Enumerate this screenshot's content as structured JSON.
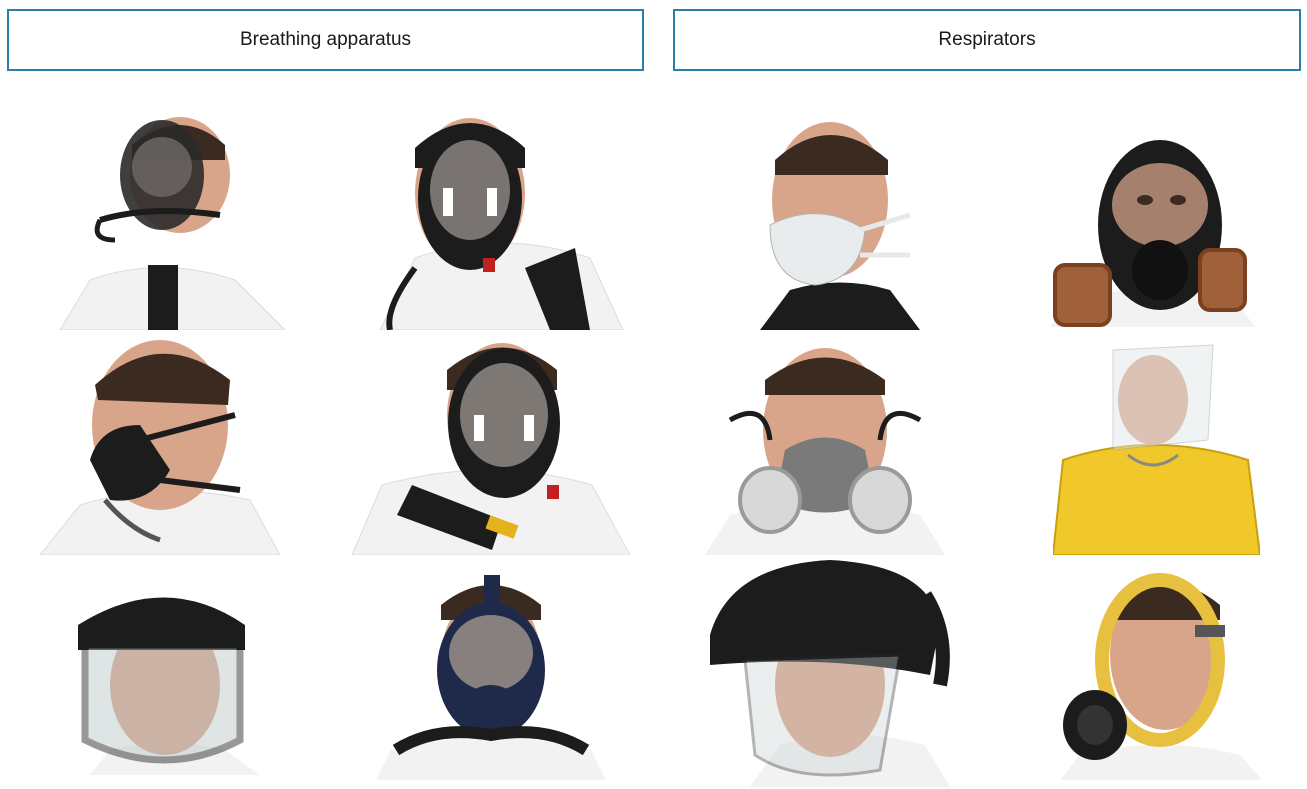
{
  "sections": {
    "left_title": "Breathing apparatus",
    "right_title": "Respirators"
  },
  "colors": {
    "header_border": "#2b7fa6",
    "skin": "#d9a58a",
    "hair": "#3a2a20",
    "suit": "#f2f2f2",
    "mask_black": "#1c1c1c",
    "mask_blue": "#1f2a4a",
    "filter_brown": "#a0603a",
    "mask_grey": "#7a7a7a",
    "suit_yellow": "#f0c82a",
    "visor_yellow": "#e8c040"
  },
  "left_items": [
    {
      "icon": "full-face-mask-hose-icon"
    },
    {
      "icon": "full-face-mask-harness-icon"
    },
    {
      "icon": "half-mask-airline-icon"
    },
    {
      "icon": "full-face-mask-cylinder-icon"
    },
    {
      "icon": "face-shield-helmet-icon"
    },
    {
      "icon": "full-face-mask-blue-icon"
    }
  ],
  "right_items": [
    {
      "icon": "disposable-respirator-icon"
    },
    {
      "icon": "full-face-mask-twin-filters-icon"
    },
    {
      "icon": "half-mask-twin-filters-icon"
    },
    {
      "icon": "escape-hood-yellow-suit-icon"
    },
    {
      "icon": "powered-air-hood-icon"
    },
    {
      "icon": "full-face-mask-yellow-icon"
    }
  ]
}
